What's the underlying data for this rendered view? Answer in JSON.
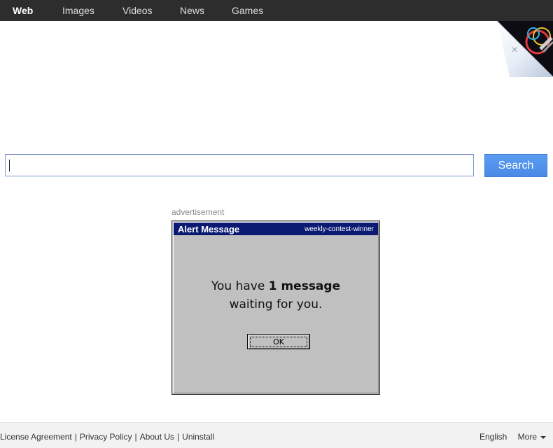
{
  "nav": {
    "items": [
      {
        "label": "Web",
        "active": true
      },
      {
        "label": "Images",
        "active": false
      },
      {
        "label": "Videos",
        "active": false
      },
      {
        "label": "News",
        "active": false
      },
      {
        "label": "Games",
        "active": false
      }
    ]
  },
  "corner_ad": {
    "close_glyph": "×"
  },
  "search": {
    "value": "",
    "placeholder": "",
    "button_label": "Search"
  },
  "ad": {
    "label": "advertisement",
    "title": "Alert Message",
    "title_right": "weekly-contest-winner",
    "message_prefix": "You have ",
    "message_bold": "1 message",
    "message_line2": "waiting for you.",
    "ok_label": "OK"
  },
  "footer": {
    "links": [
      "License Agreement",
      "Privacy Policy",
      "About Us",
      "Uninstall"
    ],
    "separator": "|",
    "language": "English",
    "more_label": "More"
  },
  "colors": {
    "nav_bg": "#2d2d2d",
    "search_button": "#4a8ae6",
    "ad_titlebar": "#0a1a72",
    "ad_body": "#c0c0c0"
  }
}
